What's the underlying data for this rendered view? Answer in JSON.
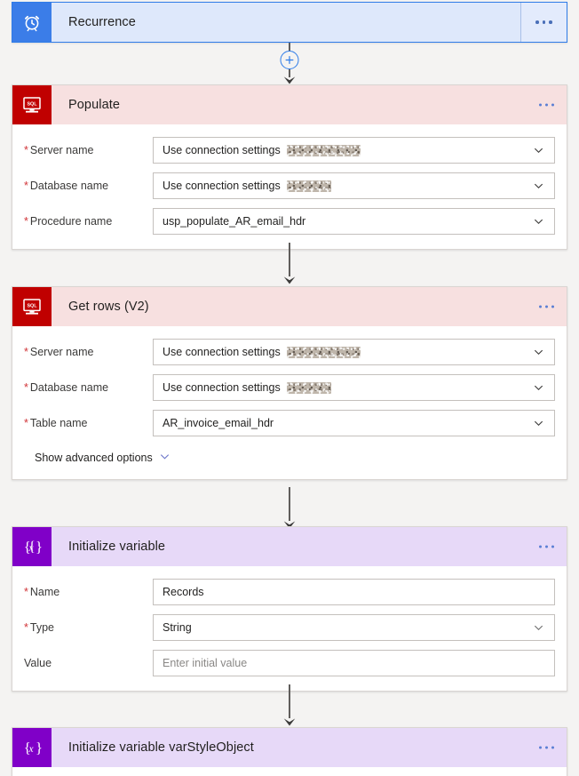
{
  "canvas": {
    "background_color": "#f4f3f2"
  },
  "colors": {
    "trigger_blue": "#3b7de8",
    "trigger_card_bg": "#dee8fb",
    "sql_red": "#c00000",
    "sql_header_bg": "#f7e0e0",
    "variable_purple": "#8000c8",
    "variable_header_bg": "#e7d9f8",
    "required_asterisk": "#d13438",
    "connector_gray": "#605e5c"
  },
  "steps": [
    {
      "id": "recurrence",
      "title": "Recurrence",
      "icon": "alarm-clock-icon",
      "type": "trigger",
      "menu_label": "...",
      "expanded": false
    },
    {
      "id": "populate",
      "title": "Populate",
      "icon": "sql-server-icon",
      "type": "sql",
      "menu_label": "...",
      "expanded": true,
      "fields": [
        {
          "label": "Server name",
          "required": true,
          "value": "Use connection settings",
          "redacted": true,
          "redact_width": 83,
          "control": "dropdown",
          "placeholder": false
        },
        {
          "label": "Database name",
          "required": true,
          "value": "Use connection settings",
          "redacted": true,
          "redact_width": 50,
          "control": "dropdown",
          "placeholder": false
        },
        {
          "label": "Procedure name",
          "required": true,
          "value": "usp_populate_AR_email_hdr",
          "redacted": false,
          "control": "dropdown",
          "placeholder": false
        }
      ]
    },
    {
      "id": "get-rows-v2",
      "title": "Get rows (V2)",
      "icon": "sql-server-icon",
      "type": "sql",
      "menu_label": "...",
      "expanded": true,
      "fields": [
        {
          "label": "Server name",
          "required": true,
          "value": "Use connection settings",
          "redacted": true,
          "redact_width": 83,
          "control": "dropdown",
          "placeholder": false
        },
        {
          "label": "Database name",
          "required": true,
          "value": "Use connection settings",
          "redacted": true,
          "redact_width": 50,
          "control": "dropdown",
          "placeholder": false
        },
        {
          "label": "Table name",
          "required": true,
          "value": "AR_invoice_email_hdr",
          "redacted": false,
          "control": "dropdown",
          "placeholder": false
        }
      ],
      "advanced_options_label": "Show advanced options"
    },
    {
      "id": "initialize-variable",
      "title": "Initialize variable",
      "icon": "variable-braces-icon",
      "type": "variable",
      "menu_label": "...",
      "expanded": true,
      "fields": [
        {
          "label": "Name",
          "required": true,
          "value": "Records",
          "redacted": false,
          "control": "text",
          "placeholder": false
        },
        {
          "label": "Type",
          "required": true,
          "value": "String",
          "redacted": false,
          "control": "dropdown",
          "placeholder": false
        },
        {
          "label": "Value",
          "required": false,
          "value": "Enter initial value",
          "redacted": false,
          "control": "text",
          "placeholder": true
        }
      ]
    },
    {
      "id": "initialize-variable-varstyleobject",
      "title": "Initialize variable varStyleObject",
      "icon": "variable-braces-icon",
      "type": "variable",
      "menu_label": "...",
      "expanded": false
    }
  ],
  "connectors": [
    {
      "has_add_button": true,
      "add_button_label": "+"
    },
    {
      "has_add_button": false,
      "add_button_label": ""
    },
    {
      "has_add_button": false,
      "add_button_label": ""
    },
    {
      "has_add_button": false,
      "add_button_label": ""
    }
  ]
}
